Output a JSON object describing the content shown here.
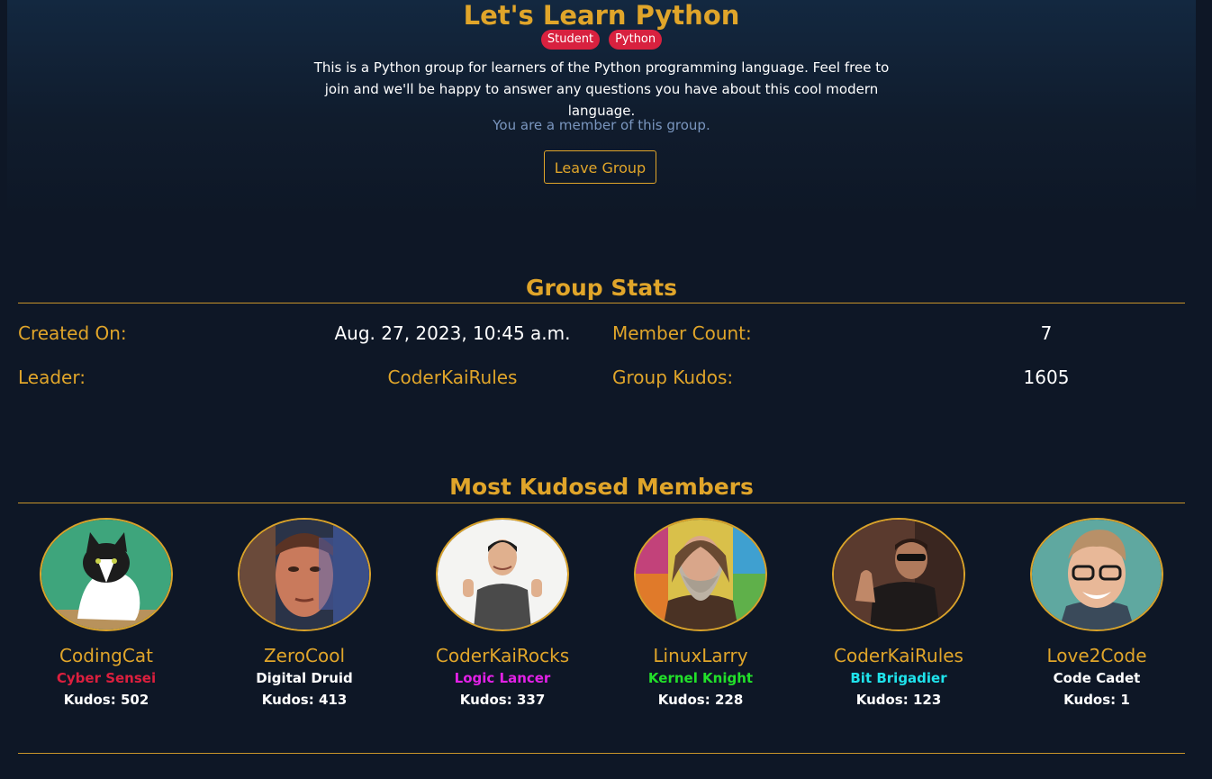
{
  "group": {
    "title": "Let's Learn Python",
    "tags": [
      "Student",
      "Python"
    ],
    "description": "This is a Python group for learners of the Python programming language. Feel free to join and we'll be happy to answer any questions you have about this cool modern language.",
    "membership_status": "You are a member of this group.",
    "leave_button": "Leave Group"
  },
  "stats": {
    "heading": "Group Stats",
    "created_on_label": "Created On:",
    "created_on_value": "Aug. 27, 2023, 10:45 a.m.",
    "member_count_label": "Member Count:",
    "member_count_value": "7",
    "leader_label": "Leader:",
    "leader_value": "CoderKaiRules",
    "group_kudos_label": "Group Kudos:",
    "group_kudos_value": "1605"
  },
  "members_section": {
    "heading": "Most Kudosed Members",
    "members": [
      {
        "name": "CodingCat",
        "rank": "Cyber Sensei",
        "rank_color": "#dc1f3e",
        "kudos": "Kudos: 502"
      },
      {
        "name": "ZeroCool",
        "rank": "Digital Druid",
        "rank_color": "#ffffff",
        "kudos": "Kudos: 413"
      },
      {
        "name": "CoderKaiRocks",
        "rank": "Logic Lancer",
        "rank_color": "#e221e6",
        "kudos": "Kudos: 337"
      },
      {
        "name": "LinuxLarry",
        "rank": "Kernel Knight",
        "rank_color": "#22e02a",
        "kudos": "Kudos: 228"
      },
      {
        "name": "CoderKaiRules",
        "rank": "Bit Brigadier",
        "rank_color": "#1fe3ec",
        "kudos": "Kudos: 123"
      },
      {
        "name": "Love2Code",
        "rank": "Code Cadet",
        "rank_color": "#ffffff",
        "kudos": "Kudos: 1"
      }
    ]
  },
  "colors": {
    "accent": "#e0a52a",
    "background": "#0e1726",
    "badge": "#d8213f"
  }
}
